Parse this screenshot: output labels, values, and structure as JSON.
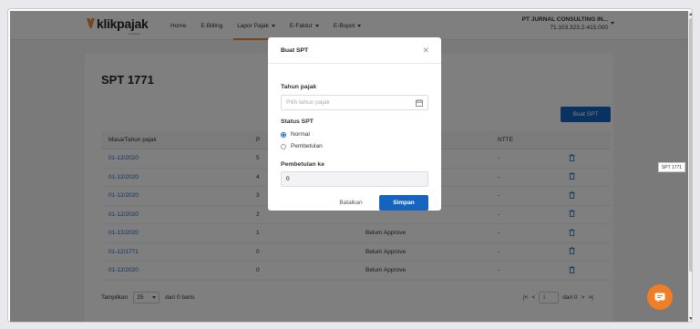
{
  "header": {
    "logo_text": "klikpajak",
    "logo_sub": "by Mekari",
    "nav": [
      {
        "label": "Home",
        "caret": false
      },
      {
        "label": "E-Billing",
        "caret": false
      },
      {
        "label": "Lapor Pajak",
        "caret": true
      },
      {
        "label": "E-Faktur",
        "caret": true
      },
      {
        "label": "E-Bupot",
        "caret": true
      }
    ],
    "company_name": "PT JURNAL CONSULTING IN...",
    "company_npwp": "71.103.323.2-415.000"
  },
  "page": {
    "title": "SPT 1771",
    "create_button": "Buat SPT",
    "columns": [
      "Masa/Tahun pajak",
      "P",
      "",
      "NTTE",
      ""
    ],
    "rows": [
      {
        "period": "01-12/2020",
        "p": "5",
        "status": "",
        "ntte": "-"
      },
      {
        "period": "01-12/2020",
        "p": "4",
        "status": "",
        "ntte": "-"
      },
      {
        "period": "01-12/2020",
        "p": "3",
        "status": "",
        "ntte": "-"
      },
      {
        "period": "01-12/2020",
        "p": "2",
        "status": "",
        "ntte": "-"
      },
      {
        "period": "01-12/2020",
        "p": "1",
        "status": "Belum Approve",
        "ntte": "-"
      },
      {
        "period": "01-12/1771",
        "p": "0",
        "status": "Belum Approve",
        "ntte": "-"
      },
      {
        "period": "01-12/2020",
        "p": "0",
        "status": "Belum Approve",
        "ntte": "-"
      }
    ],
    "footer": {
      "show_label": "Tampilkan",
      "page_size": "25",
      "of_label": "dari 0 baris",
      "page_input": "1",
      "page_of": "dari 0"
    }
  },
  "modal": {
    "title": "Buat SPT",
    "tahun_label": "Tahun pajak",
    "tahun_placeholder": "Pilih tahun pajak",
    "status_label": "Status SPT",
    "status_options": [
      "Normal",
      "Pembetulan"
    ],
    "selected_status": "Normal",
    "pembetulan_label": "Pembetulan ke",
    "pembetulan_value": "0",
    "cancel_label": "Batalkan",
    "save_label": "Simpan"
  },
  "tooltip": "SPT 1771",
  "colors": {
    "primary": "#1565c0",
    "accent": "#e98a2b",
    "chat": "#f17d24"
  }
}
